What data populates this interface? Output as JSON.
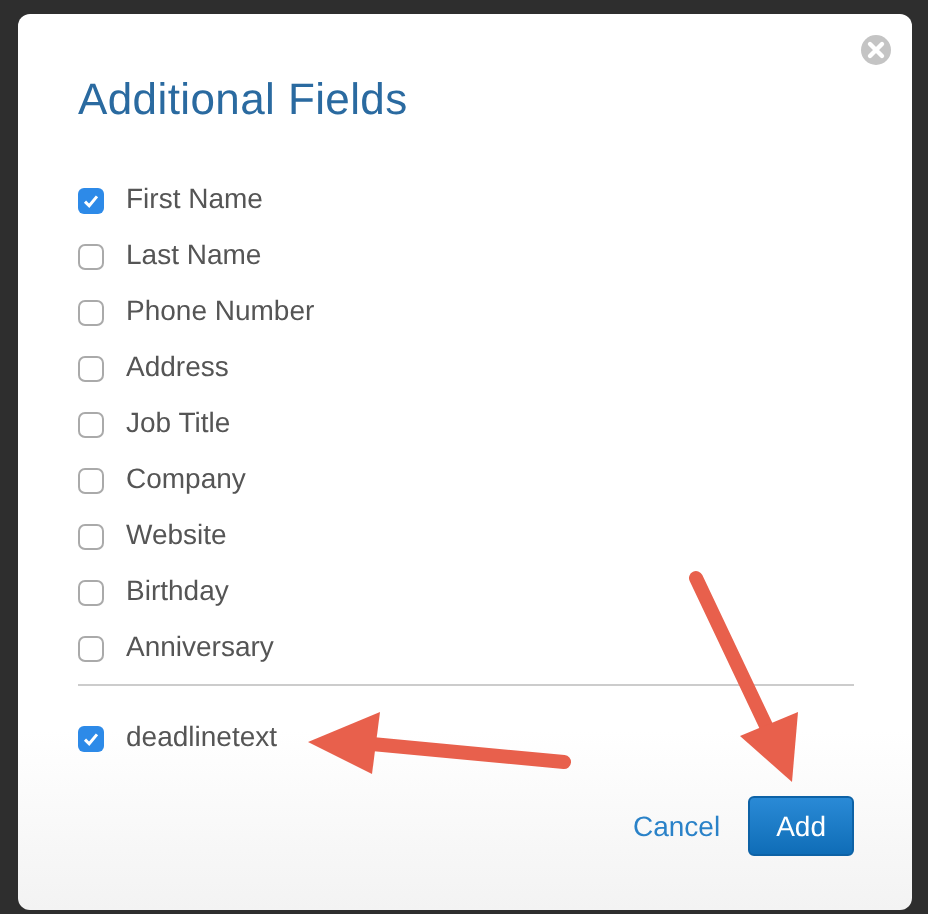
{
  "dialog": {
    "title": "Additional Fields",
    "fields": [
      {
        "label": "First Name",
        "checked": true
      },
      {
        "label": "Last Name",
        "checked": false
      },
      {
        "label": "Phone Number",
        "checked": false
      },
      {
        "label": "Address",
        "checked": false
      },
      {
        "label": "Job Title",
        "checked": false
      },
      {
        "label": "Company",
        "checked": false
      },
      {
        "label": "Website",
        "checked": false
      },
      {
        "label": "Birthday",
        "checked": false
      },
      {
        "label": "Anniversary",
        "checked": false
      }
    ],
    "custom_fields": [
      {
        "label": "deadlinetext",
        "checked": true
      }
    ],
    "buttons": [
      {
        "label": "Cancel",
        "kind": "link"
      },
      {
        "label": "Add",
        "kind": "primary"
      }
    ]
  }
}
